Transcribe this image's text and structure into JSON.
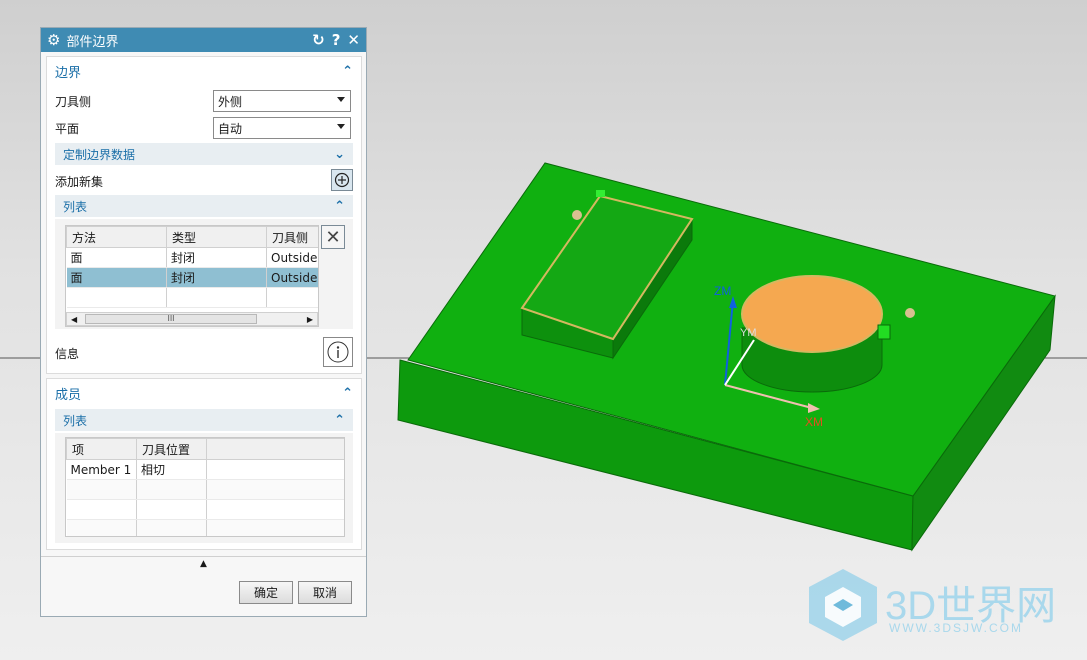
{
  "dialog": {
    "title": "部件边界",
    "icons": [
      "gear-icon",
      "reset-icon",
      "help-icon",
      "close-icon"
    ],
    "boundary_section": {
      "header": "边界",
      "tool_side_label": "刀具侧",
      "tool_side_value": "外侧",
      "plane_label": "平面",
      "plane_value": "自动",
      "custom_data_label": "定制边界数据",
      "add_new_set_label": "添加新集",
      "list_header": "列表",
      "list_columns": [
        "方法",
        "类型",
        "刀具侧"
      ],
      "list_rows": [
        [
          "面",
          "封闭",
          "Outside"
        ],
        [
          "面",
          "封闭",
          "Outside"
        ]
      ],
      "selected_row": 1,
      "scroll_thumb": "III",
      "info_label": "信息"
    },
    "members_section": {
      "header": "成员",
      "list_header": "列表",
      "columns": [
        "项",
        "刀具位置"
      ],
      "rows": [
        [
          "Member 1",
          "相切"
        ]
      ]
    },
    "ok_label": "确定",
    "cancel_label": "取消"
  },
  "viewport": {
    "axis_zm": "ZM",
    "axis_ym": "YM",
    "axis_xm": "XM",
    "colors": {
      "part_green": "#10a010",
      "boss_face": "#f5a850",
      "boundary": "#d4b860",
      "axis_z": "#1060e0",
      "axis_x": "#e05020"
    }
  },
  "watermark": {
    "brand": "3D世界网",
    "url": "WWW.3DSJW.COM"
  }
}
